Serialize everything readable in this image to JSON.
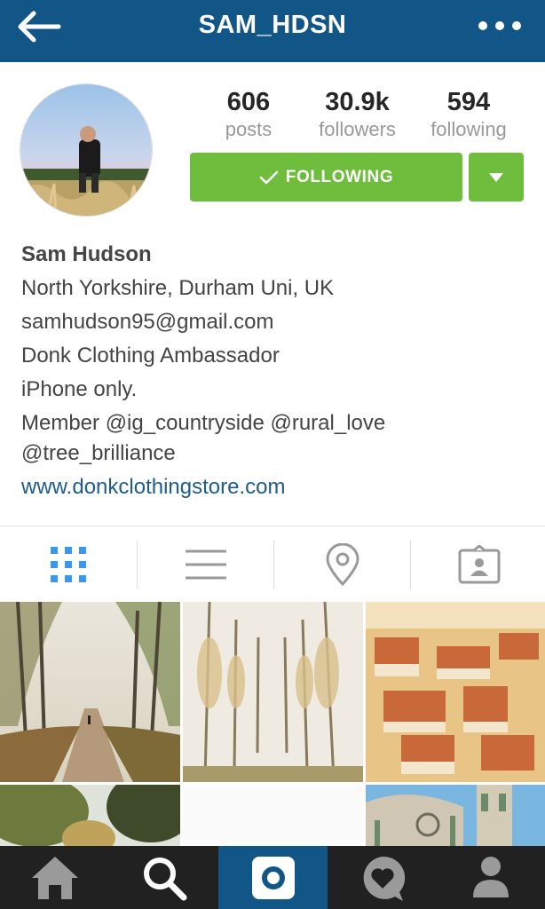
{
  "header": {
    "username": "SAM_HDSN",
    "back_icon": "arrow-left-icon",
    "more_icon": "more-dots-icon",
    "bg_color": "#125688"
  },
  "stats": {
    "posts": {
      "value": "606",
      "label": "posts"
    },
    "followers": {
      "value": "30.9k",
      "label": "followers"
    },
    "following": {
      "value": "594",
      "label": "following"
    }
  },
  "actions": {
    "follow_label": "FOLLOWING",
    "follow_color": "#6ebd3c"
  },
  "bio": {
    "name": "Sam Hudson",
    "lines": [
      "North Yorkshire, Durham Uni, UK",
      "samhudson95@gmail.com",
      "Donk Clothing Ambassador",
      "iPhone only.",
      "Member @ig_countryside @rural_love @tree_brilliance"
    ],
    "link": "www.donkclothingstore.com",
    "link_color": "#1f5c8b"
  },
  "tabs": [
    {
      "icon": "grid-icon",
      "active": true
    },
    {
      "icon": "list-icon",
      "active": false
    },
    {
      "icon": "location-pin-icon",
      "active": false
    },
    {
      "icon": "tagged-photos-icon",
      "active": false
    }
  ],
  "bottom_nav": [
    {
      "icon": "home-icon",
      "active": false
    },
    {
      "icon": "search-icon",
      "active": false
    },
    {
      "icon": "camera-icon",
      "active": true
    },
    {
      "icon": "activity-heart-icon",
      "active": false
    },
    {
      "icon": "profile-icon",
      "active": false
    }
  ]
}
